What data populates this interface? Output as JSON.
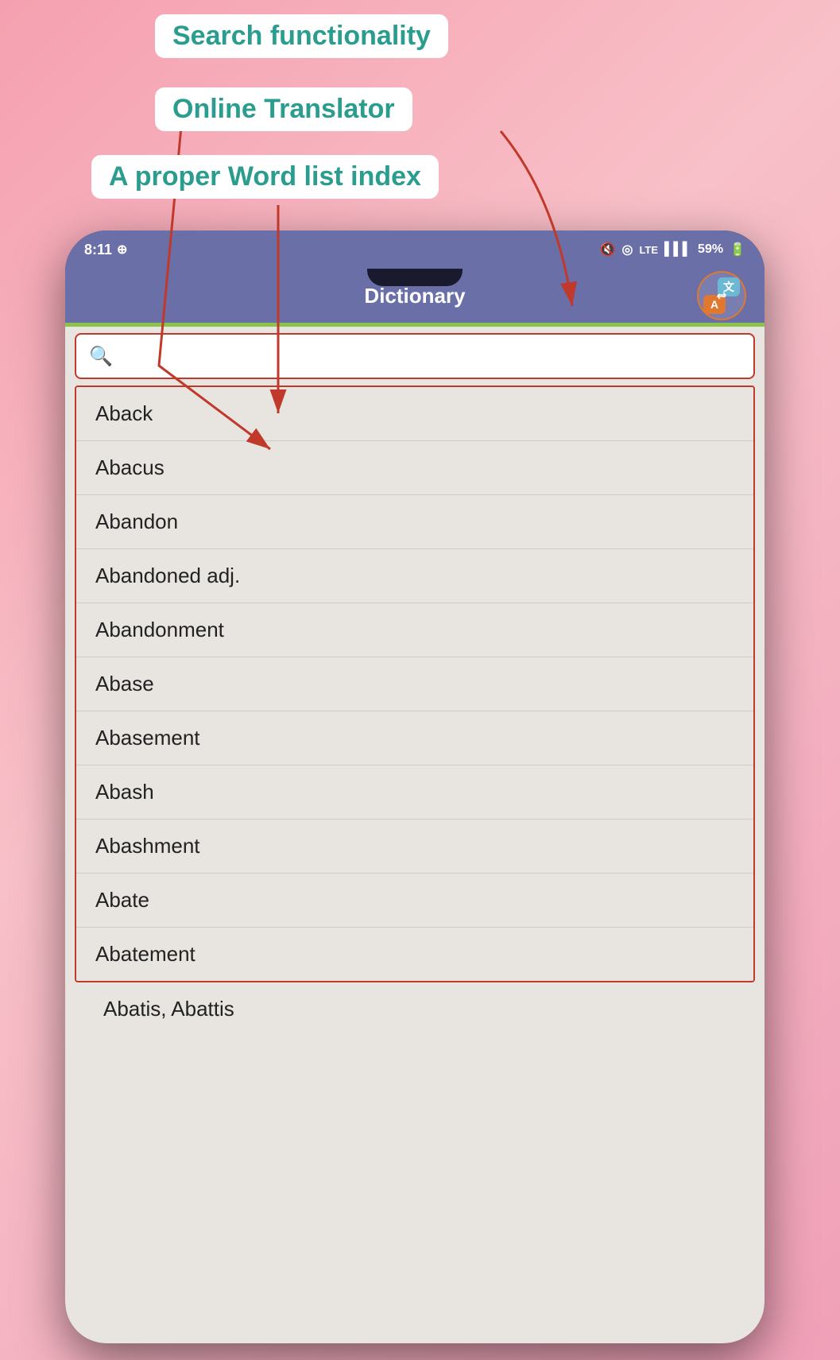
{
  "annotations": {
    "label1": "Search functionality",
    "label2": "Online Translator",
    "label3": "A proper Word list index"
  },
  "statusBar": {
    "time": "8:11",
    "battery": "59%"
  },
  "appBar": {
    "title": "Dictionary",
    "translatorLabel": "Translate"
  },
  "search": {
    "placeholder": ""
  },
  "wordList": [
    "Aback",
    "Abacus",
    "Abandon",
    "Abandoned adj.",
    "Abandonment",
    "Abase",
    "Abasement",
    "Abash",
    "Abashment",
    "Abate",
    "Abatement"
  ],
  "wordListOutside": "Abatis, Abattis",
  "icons": {
    "search": "🔍",
    "translate_zh": "文",
    "translate_en": "A"
  }
}
